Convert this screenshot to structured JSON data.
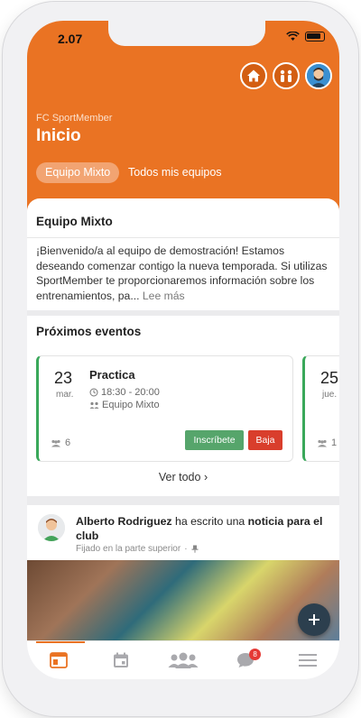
{
  "status_bar": {
    "time": "2.07"
  },
  "header": {
    "org_name": "FC SportMember",
    "title": "Inicio",
    "tabs": [
      {
        "label": "Equipo Mixto",
        "active": true
      },
      {
        "label": "Todos mis equipos",
        "active": false
      }
    ],
    "accent_color": "#ea7323"
  },
  "team_card": {
    "title": "Equipo Mixto",
    "welcome_text": "¡Bienvenido/a al equipo de demostración! Estamos deseando comenzar contigo la nueva temporada. Si utilizas SportMember te proporcionaremos información sobre los entrenamientos, pa...",
    "read_more": "Lee más"
  },
  "events": {
    "title": "Próximos eventos",
    "items": [
      {
        "day": "23",
        "month": "mar.",
        "name": "Practica",
        "time": "18:30 - 20:00",
        "team": "Equipo Mixto",
        "attendees": "6",
        "join_label": "Inscríbete",
        "leave_label": "Baja"
      },
      {
        "day": "25",
        "month": "jue.",
        "attendees": "1"
      }
    ],
    "see_all": "Ver todo"
  },
  "post": {
    "author": "Alberto Rodriguez",
    "action": "ha escrito una",
    "object": "noticia para el club",
    "pinned": "Fijado en la parte superior"
  },
  "bottom_nav": {
    "items": [
      {
        "icon": "feed-icon",
        "active": true
      },
      {
        "icon": "calendar-icon",
        "active": false
      },
      {
        "icon": "members-icon",
        "active": false
      },
      {
        "icon": "chat-icon",
        "active": false,
        "badge": "8"
      },
      {
        "icon": "menu-icon",
        "active": false
      }
    ]
  }
}
